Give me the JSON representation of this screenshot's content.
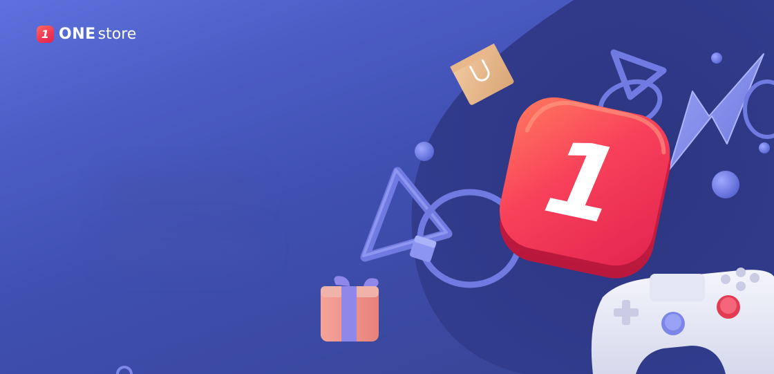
{
  "brand": {
    "mark": "1",
    "name_bold": "ONE",
    "name_light": "store"
  },
  "hero": {
    "badge_numeral": "1"
  },
  "colors": {
    "background_top": "#5e71dc",
    "background_bottom": "#35448f",
    "blob": "#2f3a86",
    "brand_red": "#f23a55",
    "accent_periwinkle": "#7b86e8"
  },
  "icons": [
    "shopping-bag-icon",
    "gift-box-icon",
    "game-controller-icon",
    "lightning-bolt-icon",
    "triangle-shape-icon",
    "ring-shape-icon",
    "cube-shape-icon",
    "sphere-shape-icon"
  ]
}
